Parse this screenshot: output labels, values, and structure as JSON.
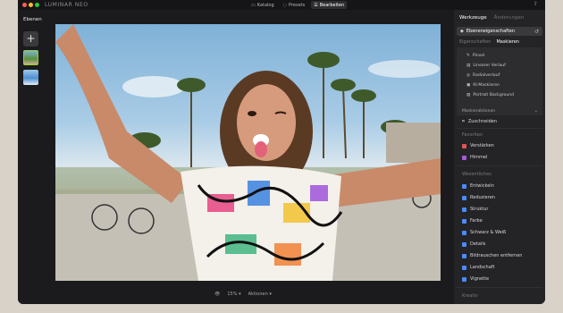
{
  "titlebar": {
    "brand": "LUMINAR NEO",
    "tabs": [
      {
        "label": "Katalog",
        "icon": "catalog-icon"
      },
      {
        "label": "Presets",
        "icon": "presets-icon"
      },
      {
        "label": "Bearbeiten",
        "icon": "edit-icon"
      }
    ],
    "active_tab": "Bearbeiten"
  },
  "layers": {
    "title": "Ebenen"
  },
  "bottom": {
    "zoom": "15%",
    "actions": "Aktionen"
  },
  "panel": {
    "tabs": [
      "Werkzeuge",
      "Änderungen"
    ],
    "layer_props": "Ebeneneigenschaften",
    "subtabs": [
      "Eigenschaften",
      "Maskieren"
    ],
    "mask_items": [
      "Pinsel",
      "Linearer Verlauf",
      "Radialverlauf",
      "KI-Maskieren",
      "Portrait Background"
    ],
    "mask_actions": "Maskieraktionen",
    "crop": "Zuschneiden",
    "favorites_title": "Favoriten",
    "favorites": [
      "Verstärken",
      "Himmel"
    ],
    "essentials_title": "Wesentliches",
    "essentials": [
      "Entwickeln",
      "Reduzieren",
      "Struktur",
      "Farbe",
      "Schwarz & Weiß",
      "Details",
      "Bildrauschen entfernen",
      "Landschaft",
      "Vignette"
    ],
    "creative_title": "Kreativ"
  },
  "colors": {
    "accent": "#4a8cff",
    "traffic_red": "#ff5f57",
    "traffic_yellow": "#febc2e",
    "traffic_green": "#28c840"
  }
}
